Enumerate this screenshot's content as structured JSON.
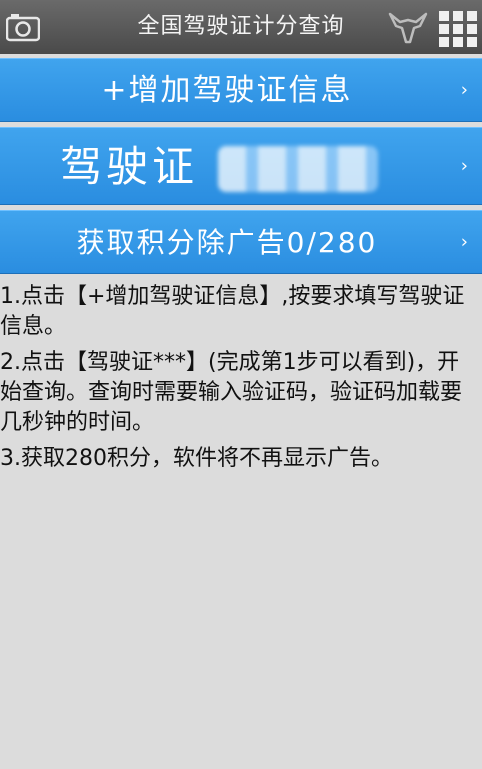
{
  "header": {
    "title": "全国驾驶证计分查询",
    "camera_icon": "camera-icon",
    "logo_icon": "bull-logo-icon",
    "menu_icon": "grid-menu-icon"
  },
  "buttons": [
    {
      "label": "+增加驾驶证信息",
      "chevron": "›"
    },
    {
      "label": "驾驶证",
      "chevron": "›"
    },
    {
      "label": "获取积分除广告0/280",
      "chevron": "›"
    }
  ],
  "instructions": [
    "1.点击【+增加驾驶证信息】,按要求填写驾驶证信息。",
    "2.点击【驾驶证***】(完成第1步可以看到)，开始查询。查询时需要输入验证码，验证码加载要几秒钟的时间。",
    "3.获取280积分，软件将不再显示广告。"
  ],
  "colors": {
    "accent": "#2a8de0",
    "header": "#555555",
    "background": "#dcdcdc"
  }
}
